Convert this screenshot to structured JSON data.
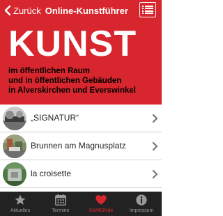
{
  "nav": {
    "back_label": "Zurück",
    "title": "Online-Kunstführer",
    "menu_icon": "list-menu-icon"
  },
  "hero": {
    "title": "KUNST",
    "subtitle_lines": [
      "im öffentlichen Raum",
      "und in öffentlichen Gebäuden",
      "in Alverskirchen und Everswinkel"
    ]
  },
  "list": {
    "items": [
      {
        "label": "„SIGNATUR“"
      },
      {
        "label": "Brunnen am Magnusplatz"
      },
      {
        "label": "la croisette"
      }
    ]
  },
  "tabbar": {
    "tabs": [
      {
        "label": "Aktuelles",
        "icon": "star-icon"
      },
      {
        "label": "Termine",
        "icon": "calendar-icon"
      },
      {
        "label": "GeMEINde",
        "icon": "heart-icon",
        "active": true
      },
      {
        "label": "Impressum",
        "icon": "info-icon"
      }
    ]
  },
  "colors": {
    "brand_red": "#d7262d",
    "tabbar_bg": "#222222",
    "tab_inactive": "#9a9a9a"
  }
}
